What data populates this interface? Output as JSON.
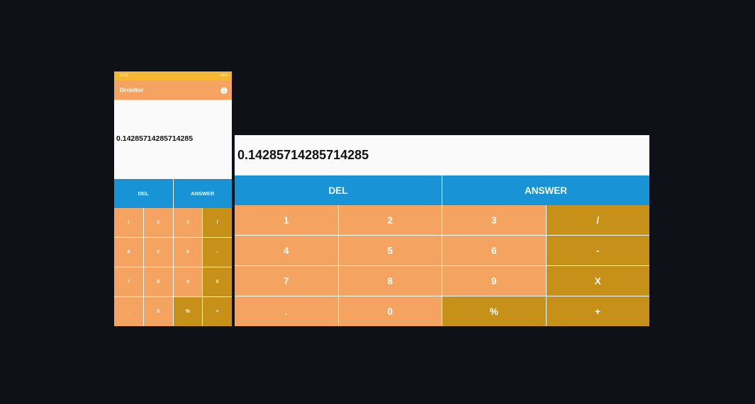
{
  "colors": {
    "background": "#0e1118",
    "status_bar": "#f5b731",
    "app_bar": "#f4a460",
    "number_key": "#f4a460",
    "operator_key": "#c69019",
    "action_key": "#1793d6",
    "display_bg": "#fafafa"
  },
  "status_bar": {
    "time": "15:33",
    "right": "89%"
  },
  "app": {
    "title": "Droidtor",
    "info_icon": "info-icon"
  },
  "display": {
    "value": "0.14285714285714285"
  },
  "actions": {
    "del_label": "DEL",
    "answer_label": "ANSWER"
  },
  "keys": [
    {
      "label": "1",
      "type": "num",
      "name": "key-1"
    },
    {
      "label": "2",
      "type": "num",
      "name": "key-2"
    },
    {
      "label": "3",
      "type": "num",
      "name": "key-3"
    },
    {
      "label": "/",
      "type": "op",
      "name": "key-divide"
    },
    {
      "label": "4",
      "type": "num",
      "name": "key-4"
    },
    {
      "label": "5",
      "type": "num",
      "name": "key-5"
    },
    {
      "label": "6",
      "type": "num",
      "name": "key-6"
    },
    {
      "label": "-",
      "type": "op",
      "name": "key-minus"
    },
    {
      "label": "7",
      "type": "num",
      "name": "key-7"
    },
    {
      "label": "8",
      "type": "num",
      "name": "key-8"
    },
    {
      "label": "9",
      "type": "num",
      "name": "key-9"
    },
    {
      "label": "X",
      "type": "op",
      "name": "key-multiply"
    },
    {
      "label": ".",
      "type": "num",
      "name": "key-decimal"
    },
    {
      "label": "0",
      "type": "num",
      "name": "key-0"
    },
    {
      "label": "%",
      "type": "op",
      "name": "key-percent"
    },
    {
      "label": "+",
      "type": "op",
      "name": "key-plus"
    }
  ]
}
